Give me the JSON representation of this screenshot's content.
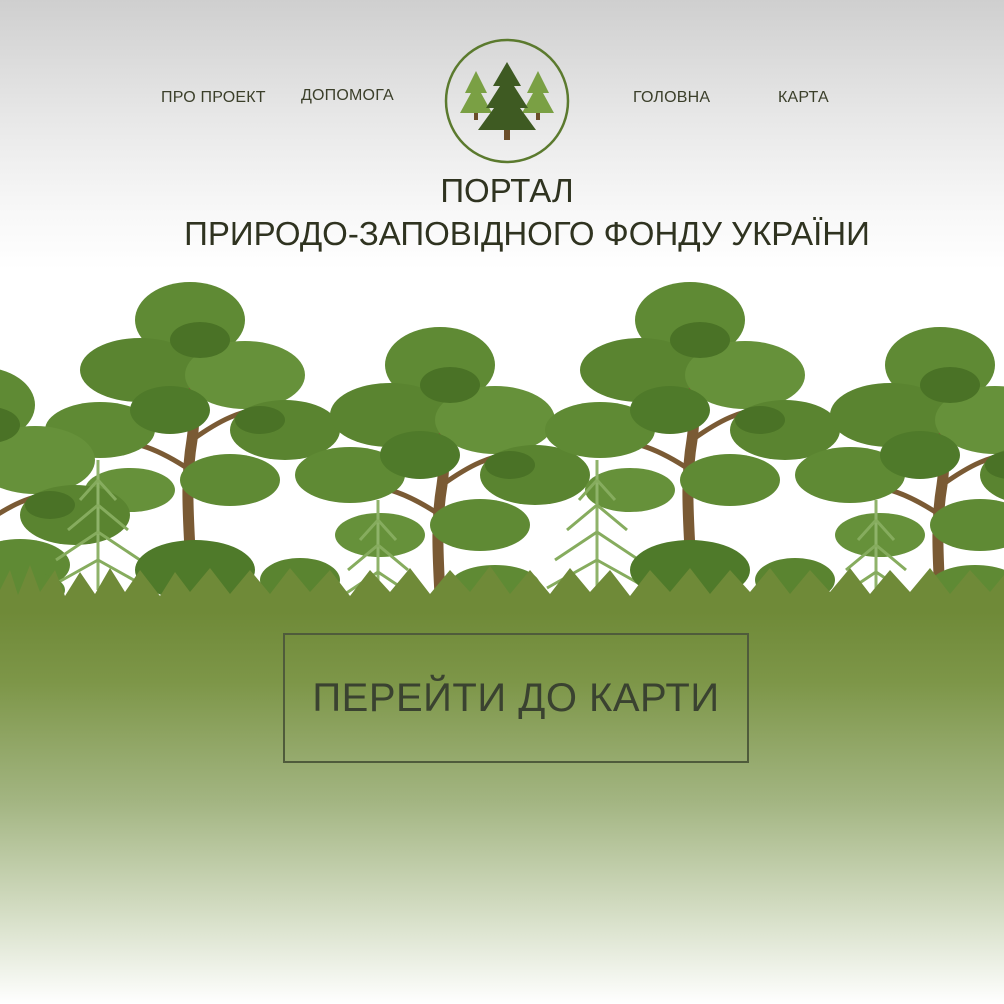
{
  "nav": {
    "about": "ПРО ПРОЕКТ",
    "help": "ДОПОМОГА",
    "home": "ГОЛОВНА",
    "map": "КАРТА"
  },
  "logo": {
    "icon": "fir-trees-logo-icon",
    "ring_color": "#5b7a2e"
  },
  "header": {
    "title_line1": "ПОРТАЛ",
    "title_line2": "ПРИРОДО-ЗАПОВІДНОГО ФОНДУ УКРАЇНИ"
  },
  "hero": {
    "illustration": "forest-illustration"
  },
  "cta": {
    "label": "ПЕРЕЙТИ ДО КАРТИ"
  },
  "colors": {
    "foliage": "#5f8a34",
    "foliage_dark": "#3f6a24",
    "ground": "#6f8a38",
    "text": "#3b3f2a"
  }
}
